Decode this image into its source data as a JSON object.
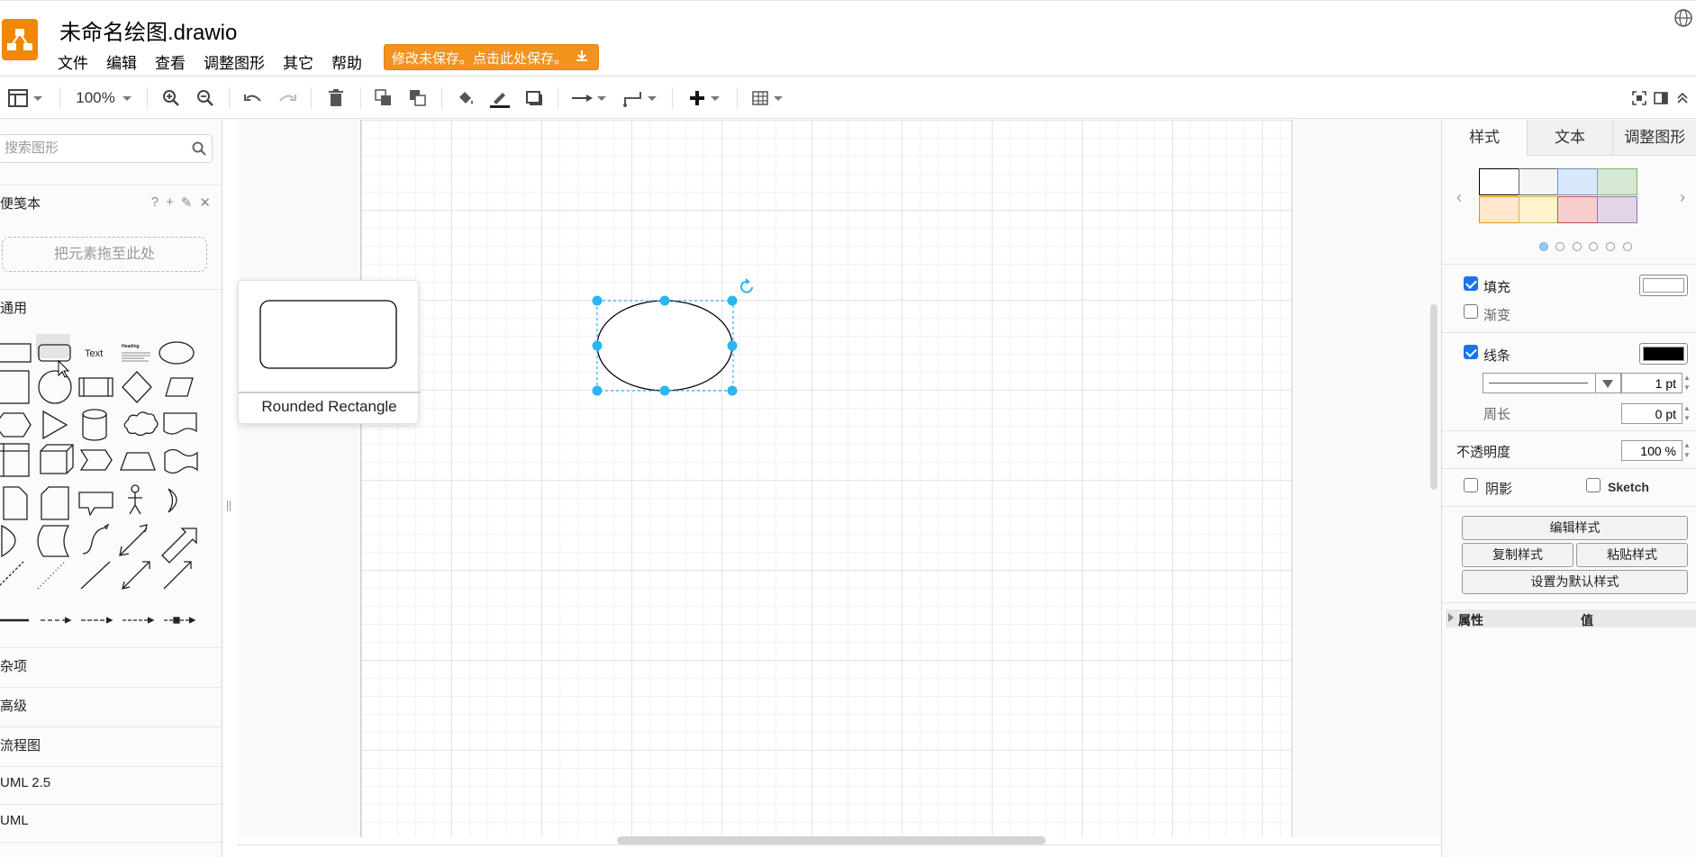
{
  "app": {
    "title": "未命名绘图.drawio",
    "menu": [
      "文件",
      "编辑",
      "查看",
      "调整图形",
      "其它",
      "帮助"
    ],
    "save_banner": "修改未保存。点击此处保存。"
  },
  "toolbar": {
    "zoom": "100%"
  },
  "sidebar": {
    "search_placeholder": "搜索图形",
    "scratchpad_title": "便笺本",
    "scratchpad_icons": [
      "?",
      "+",
      "✎",
      "✕"
    ],
    "drop_hint": "把元素拖至此处",
    "general_title": "通用",
    "shape_text_label": "Text",
    "shape_heading_label": "Heading",
    "sections": [
      "杂项",
      "高级",
      "流程图",
      "UML 2.5",
      "UML"
    ]
  },
  "tooltip": {
    "shape_name": "Rounded Rectangle"
  },
  "format_panel": {
    "tabs": [
      "样式",
      "文本",
      "调整图形"
    ],
    "swatches": [
      {
        "fill": "#ffffff",
        "stroke": "#000000"
      },
      {
        "fill": "#f5f5f5",
        "stroke": "#666666"
      },
      {
        "fill": "#dae8fc",
        "stroke": "#6c8ebf"
      },
      {
        "fill": "#d5e8d4",
        "stroke": "#82b366"
      },
      {
        "fill": "#ffe6cc",
        "stroke": "#d79b00"
      },
      {
        "fill": "#fff2cc",
        "stroke": "#d6b656"
      },
      {
        "fill": "#f8cecc",
        "stroke": "#b85450"
      },
      {
        "fill": "#e1d5e7",
        "stroke": "#9673a6"
      }
    ],
    "fill_label": "填充",
    "gradient_label": "渐变",
    "line_label": "线条",
    "line_width": "1 pt",
    "perimeter_label": "周长",
    "perimeter_value": "0 pt",
    "opacity_label": "不透明度",
    "opacity_value": "100 %",
    "shadow_label": "阴影",
    "sketch_label": "Sketch",
    "edit_style": "编辑样式",
    "copy_style": "复制样式",
    "paste_style": "粘贴样式",
    "set_default": "设置为默认样式",
    "props_col1": "属性",
    "props_col2": "值",
    "fill_color": "#ffffff",
    "line_color": "#000000"
  },
  "colors": {
    "accent": "#29b6f2",
    "logo": "#f08705",
    "save_banner": "#f2931e"
  }
}
